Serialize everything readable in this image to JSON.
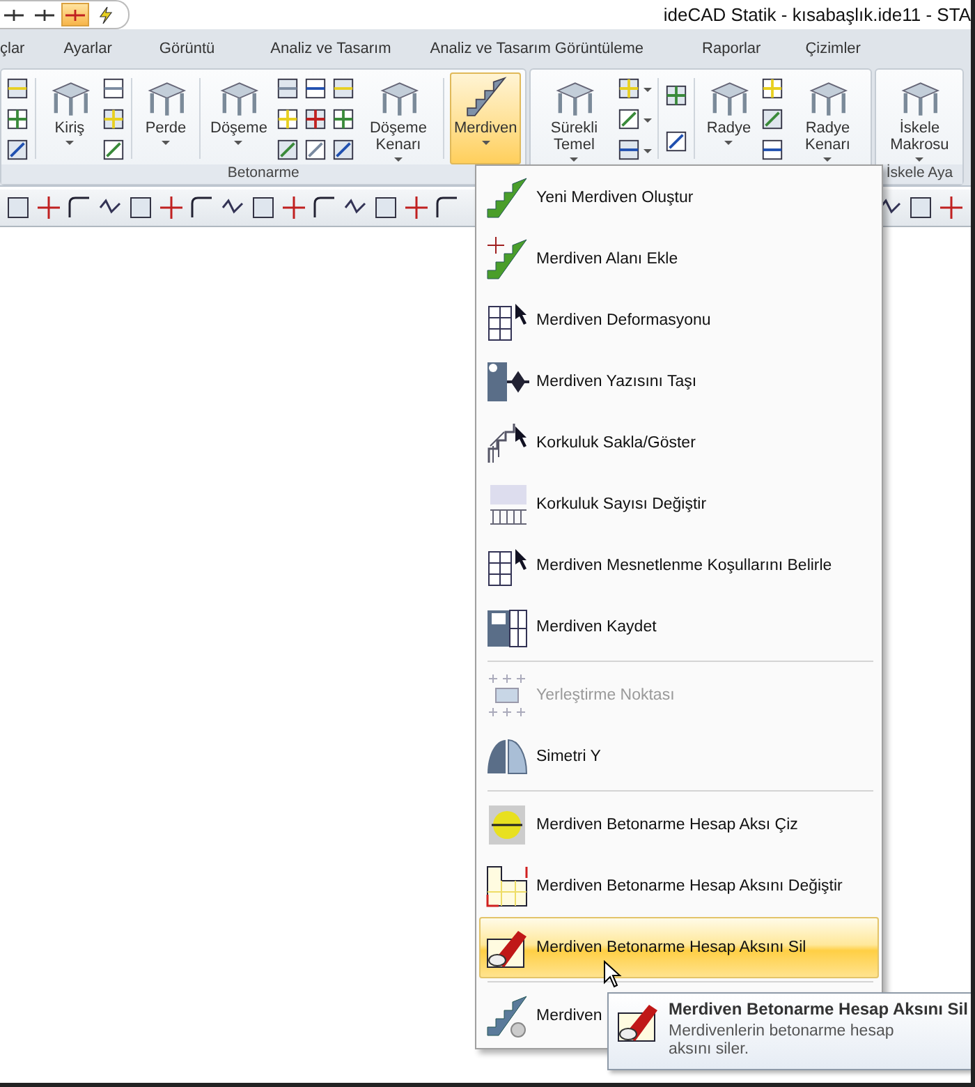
{
  "window": {
    "title": "ideCAD Statik - kısabaşlık.ide11 - STA"
  },
  "quick_access": {
    "buttons": [
      {
        "selected": false
      },
      {
        "selected": false
      },
      {
        "selected": true
      },
      {
        "selected": false
      }
    ]
  },
  "tabs": [
    {
      "label": "çlar",
      "selected": false
    },
    {
      "label": "Ayarlar",
      "selected": false
    },
    {
      "label": "Görüntü",
      "selected": false
    },
    {
      "label": "Analiz ve Tasarım",
      "selected": false
    },
    {
      "label": "Analiz ve Tasarım Görüntüleme",
      "selected": false
    },
    {
      "label": "Raporlar",
      "selected": false
    },
    {
      "label": "Çizimler",
      "selected": false
    }
  ],
  "ribbon": {
    "groups": [
      {
        "label": "Betonarme",
        "items": [
          {
            "kind": "stack",
            "carets": [
              false,
              false,
              false
            ]
          },
          {
            "kind": "separator"
          },
          {
            "kind": "large",
            "label": "Kiriş",
            "selected": false
          },
          {
            "kind": "stack",
            "carets": [
              false,
              false,
              false
            ]
          },
          {
            "kind": "separator"
          },
          {
            "kind": "large",
            "label": "Perde",
            "selected": false
          },
          {
            "kind": "separator"
          },
          {
            "kind": "large",
            "label": "Döşeme",
            "selected": false
          },
          {
            "kind": "stack",
            "carets": [
              false,
              false,
              false
            ]
          },
          {
            "kind": "stack",
            "carets": [
              false,
              false,
              false
            ]
          },
          {
            "kind": "stack",
            "carets": [
              false,
              false,
              false
            ]
          },
          {
            "kind": "large",
            "label": "Döşeme Kenarı",
            "selected": false
          },
          {
            "kind": "separator"
          },
          {
            "kind": "large",
            "label": "Merdiven",
            "selected": true
          }
        ]
      },
      {
        "items": [
          {
            "kind": "large",
            "label": "Sürekli Temel",
            "selected": false
          },
          {
            "kind": "stack",
            "carets": [
              true,
              true,
              true
            ]
          },
          {
            "kind": "separator"
          },
          {
            "kind": "stack",
            "carets": [
              false,
              false
            ]
          },
          {
            "kind": "separator"
          },
          {
            "kind": "large",
            "label": "Radye",
            "selected": false
          },
          {
            "kind": "stack",
            "carets": [
              false,
              false,
              false
            ]
          },
          {
            "kind": "large",
            "label": "Radye Kenarı",
            "selected": false
          }
        ]
      },
      {
        "label": "İskele Aya",
        "items": [
          {
            "kind": "large",
            "label": "İskele Makrosu",
            "selected": false
          }
        ]
      }
    ]
  },
  "menu": {
    "sections": [
      [
        {
          "label": "Yeni Merdiven Oluştur",
          "disabled": false,
          "selected": false
        },
        {
          "label": "Merdiven Alanı Ekle",
          "disabled": false,
          "selected": false
        },
        {
          "label": "Merdiven Deformasyonu",
          "disabled": false,
          "selected": false
        },
        {
          "label": "Merdiven Yazısını Taşı",
          "disabled": false,
          "selected": false
        },
        {
          "label": "Korkuluk Sakla/Göster",
          "disabled": false,
          "selected": false
        },
        {
          "label": "Korkuluk Sayısı Değiştir",
          "disabled": false,
          "selected": false
        },
        {
          "label": "Merdiven Mesnetlenme Koşullarını Belirle",
          "disabled": false,
          "selected": false
        },
        {
          "label": "Merdiven Kaydet",
          "disabled": false,
          "selected": false
        }
      ],
      [
        {
          "label": "Yerleştirme Noktası",
          "disabled": true,
          "selected": false
        },
        {
          "label": "Simetri Y",
          "disabled": false,
          "selected": false
        }
      ],
      [
        {
          "label": "Merdiven Betonarme Hesap Aksı Çiz",
          "disabled": false,
          "selected": false
        },
        {
          "label": "Merdiven Betonarme Hesap Aksını Değiştir",
          "disabled": false,
          "selected": false
        },
        {
          "label": "Merdiven Betonarme Hesap Aksını Sil",
          "disabled": false,
          "selected": true
        }
      ],
      [
        {
          "label": "Merdiven",
          "disabled": false,
          "selected": false
        }
      ]
    ]
  },
  "tooltip": {
    "title": "Merdiven Betonarme Hesap Aksını Sil",
    "text": "Merdivenlerin betonarme hesap aksını siler."
  }
}
